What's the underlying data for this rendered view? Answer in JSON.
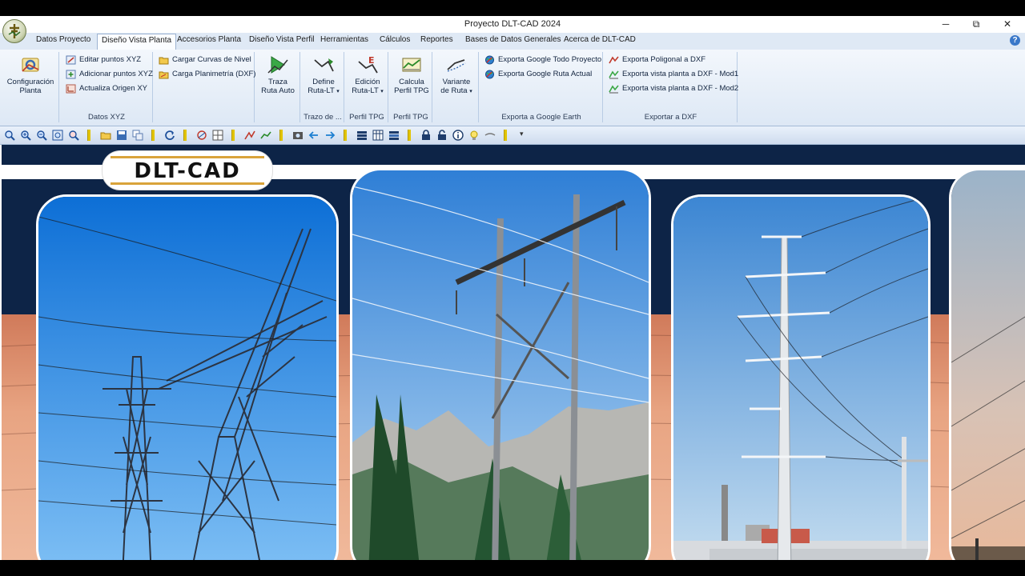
{
  "window": {
    "title": "Proyecto DLT-CAD 2024",
    "minimize": "─",
    "restore": "⧉",
    "close": "✕"
  },
  "menu": {
    "tabs": [
      "Datos Proyecto",
      "Diseño Vista Planta",
      "Accesorios Planta",
      "Diseño Vista Perfil",
      "Herramientas",
      "Cálculos",
      "Reportes",
      "Bases de Datos Generales",
      "Acerca de DLT-CAD"
    ],
    "active_tab": "Diseño Vista Planta",
    "help": "?"
  },
  "ribbon": {
    "config": {
      "label_1": "Configuración",
      "label_2": "Planta"
    },
    "datos_xyz": {
      "items": [
        "Editar puntos XYZ",
        "Adicionar puntos XYZ",
        "Actualiza Origen XY"
      ],
      "group_label": "Datos XYZ"
    },
    "curvas": {
      "items": [
        "Cargar Curvas de Nivel",
        "Carga Planimetría (DXF)"
      ]
    },
    "traza": {
      "label_1": "Traza",
      "label_2": "Ruta Auto"
    },
    "define": {
      "label_1": "Define",
      "label_2": "Ruta-LT",
      "group_label": "Trazo de ..."
    },
    "edicion": {
      "label_1": "Edición",
      "label_2": "Ruta-LT",
      "group_label": "Perfil TPG"
    },
    "calcula": {
      "label_1": "Calcula",
      "label_2": "Perfil TPG",
      "group_label": "Perfil TPG"
    },
    "variante": {
      "label_1": "Variante",
      "label_2": "de Ruta"
    },
    "google": {
      "items": [
        "Exporta Google Todo Proyecto",
        "Exporta Google Ruta Actual"
      ],
      "group_label": "Exporta a Google Earth"
    },
    "dxf": {
      "items": [
        "Exporta Poligonal a DXF",
        "Exporta vista planta a DXF - Mod1",
        "Exporta vista planta a DXF - Mod2"
      ],
      "group_label": "Exportar a DXF"
    },
    "dropdown_arrow": "▾"
  },
  "toolbar": {
    "icons": [
      "zoom-extents-icon",
      "zoom-in-icon",
      "zoom-out-icon",
      "zoom-window-icon",
      "zoom-previous-icon",
      "open-folder-icon",
      "save-icon",
      "copy-icon",
      "refresh-icon",
      "map-icon",
      "grid-icon",
      "route-icon",
      "profile-icon",
      "camera-icon",
      "arrow-left-icon",
      "arrow-right-icon",
      "layers-icon",
      "table-icon",
      "list-icon",
      "lock-icon",
      "unlock-icon",
      "info-icon",
      "light-icon",
      "line-icon"
    ],
    "overflow": "▾"
  },
  "splash": {
    "logo_text": "DLT-CAD"
  },
  "colors": {
    "navy": "#0d2447",
    "ribbon": "#dde8f5",
    "band": "#e8a482",
    "accent": "#d9a33a"
  }
}
